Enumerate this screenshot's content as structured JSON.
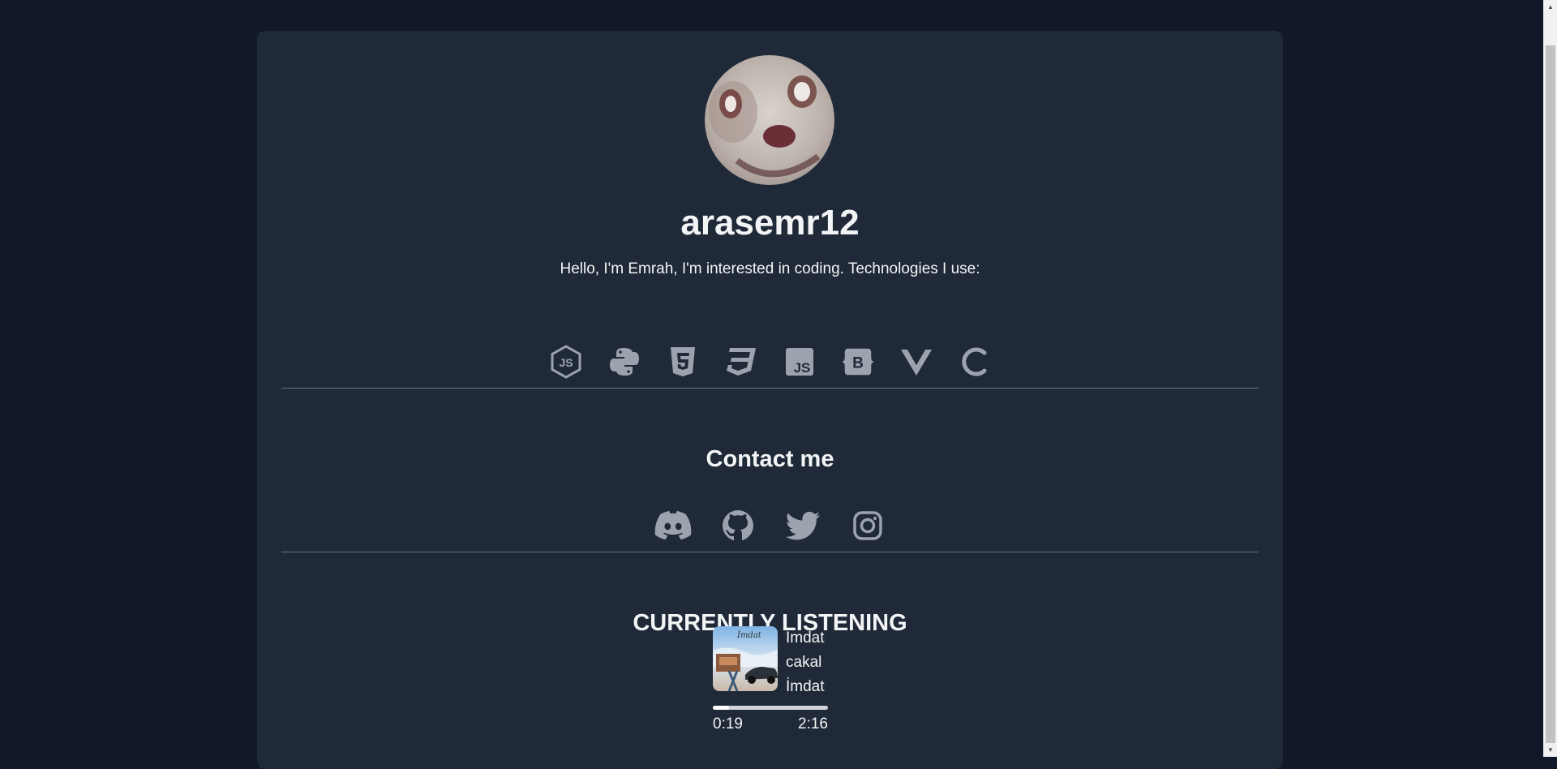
{
  "profile": {
    "username": "arasemr12",
    "bio": "Hello, I'm Emrah, I'm interested in coding. Technologies I use:"
  },
  "technologies": [
    {
      "icon": "nodejs-icon"
    },
    {
      "icon": "python-icon"
    },
    {
      "icon": "html5-icon"
    },
    {
      "icon": "css3-icon"
    },
    {
      "icon": "javascript-icon"
    },
    {
      "icon": "bootstrap-icon"
    },
    {
      "icon": "vue-icon"
    },
    {
      "icon": "c-language-icon"
    }
  ],
  "contact": {
    "title": "Contact me",
    "links": [
      {
        "icon": "discord-icon"
      },
      {
        "icon": "github-icon"
      },
      {
        "icon": "twitter-icon"
      },
      {
        "icon": "instagram-icon"
      }
    ]
  },
  "listening": {
    "title": "CURRENTLY LISTENING",
    "track": "İmdat",
    "artist": "cakal",
    "album": "İmdat",
    "elapsed": "0:19",
    "duration": "2:16",
    "progress_fraction": 0.14
  },
  "colors": {
    "page_bg": "#111827",
    "card_bg": "#1f2937",
    "icon": "#9ca3af",
    "text": "#f3f4f6"
  }
}
